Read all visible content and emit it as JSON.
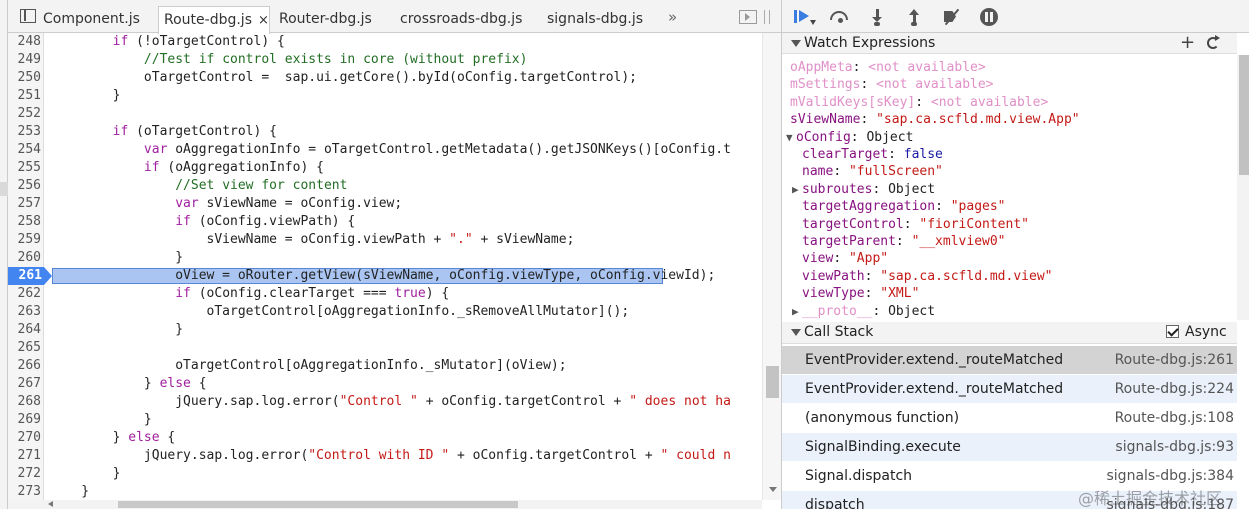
{
  "tabs": [
    {
      "label": "Component.js",
      "active": false
    },
    {
      "label": "Route-dbg.js",
      "active": true,
      "close": "×"
    },
    {
      "label": "Router-dbg.js",
      "active": false
    },
    {
      "label": "crossroads-dbg.js",
      "active": false
    },
    {
      "label": "signals-dbg.js",
      "active": false
    }
  ],
  "more_tabs": "»",
  "editor": {
    "breakpoint_line": "261",
    "lines": [
      {
        "n": "248",
        "parts": [
          {
            "t": "        ",
            "c": ""
          },
          {
            "t": "if",
            "c": "kw"
          },
          {
            "t": " (!oTargetControl) {",
            "c": ""
          }
        ]
      },
      {
        "n": "249",
        "parts": [
          {
            "t": "            ",
            "c": ""
          },
          {
            "t": "//Test if control exists in core (without prefix)",
            "c": "cm"
          }
        ]
      },
      {
        "n": "250",
        "parts": [
          {
            "t": "            oTargetControl =  sap.ui.getCore().byId(oConfig.targetControl);",
            "c": ""
          }
        ]
      },
      {
        "n": "251",
        "parts": [
          {
            "t": "        }",
            "c": ""
          }
        ]
      },
      {
        "n": "252",
        "parts": []
      },
      {
        "n": "253",
        "parts": [
          {
            "t": "        ",
            "c": ""
          },
          {
            "t": "if",
            "c": "kw"
          },
          {
            "t": " (oTargetControl) {",
            "c": ""
          }
        ]
      },
      {
        "n": "254",
        "parts": [
          {
            "t": "            ",
            "c": ""
          },
          {
            "t": "var",
            "c": "kw"
          },
          {
            "t": " oAggregationInfo = oTargetControl.getMetadata().getJSONKeys()[oConfig.t",
            "c": ""
          }
        ]
      },
      {
        "n": "255",
        "parts": [
          {
            "t": "            ",
            "c": ""
          },
          {
            "t": "if",
            "c": "kw"
          },
          {
            "t": " (oAggregationInfo) {",
            "c": ""
          }
        ]
      },
      {
        "n": "256",
        "parts": [
          {
            "t": "                ",
            "c": ""
          },
          {
            "t": "//Set view for content",
            "c": "cm"
          }
        ]
      },
      {
        "n": "257",
        "parts": [
          {
            "t": "                ",
            "c": ""
          },
          {
            "t": "var",
            "c": "kw"
          },
          {
            "t": " sViewName = oConfig.view;",
            "c": ""
          }
        ]
      },
      {
        "n": "258",
        "parts": [
          {
            "t": "                ",
            "c": ""
          },
          {
            "t": "if",
            "c": "kw"
          },
          {
            "t": " (oConfig.viewPath) {",
            "c": ""
          }
        ]
      },
      {
        "n": "259",
        "parts": [
          {
            "t": "                    sViewName = oConfig.viewPath + ",
            "c": ""
          },
          {
            "t": "\".\"",
            "c": "st"
          },
          {
            "t": " + sViewName;",
            "c": ""
          }
        ]
      },
      {
        "n": "260",
        "parts": [
          {
            "t": "                }",
            "c": ""
          }
        ]
      },
      {
        "n": "261",
        "parts": [
          {
            "t": "                oView = oRouter.getView(sViewName, oConfig.viewType, oConfig.viewId);",
            "c": ""
          }
        ]
      },
      {
        "n": "262",
        "parts": [
          {
            "t": "                ",
            "c": ""
          },
          {
            "t": "if",
            "c": "kw"
          },
          {
            "t": " (oConfig.clearTarget === ",
            "c": ""
          },
          {
            "t": "true",
            "c": "kw"
          },
          {
            "t": ") {",
            "c": ""
          }
        ]
      },
      {
        "n": "263",
        "parts": [
          {
            "t": "                    oTargetControl[oAggregationInfo._sRemoveAllMutator]();",
            "c": ""
          }
        ]
      },
      {
        "n": "264",
        "parts": [
          {
            "t": "                }",
            "c": ""
          }
        ]
      },
      {
        "n": "265",
        "parts": []
      },
      {
        "n": "266",
        "parts": [
          {
            "t": "                oTargetControl[oAggregationInfo._sMutator](oView);",
            "c": ""
          }
        ]
      },
      {
        "n": "267",
        "parts": [
          {
            "t": "            } ",
            "c": ""
          },
          {
            "t": "else",
            "c": "kw"
          },
          {
            "t": " {",
            "c": ""
          }
        ]
      },
      {
        "n": "268",
        "parts": [
          {
            "t": "                jQuery.sap.log.error(",
            "c": ""
          },
          {
            "t": "\"Control \"",
            "c": "st"
          },
          {
            "t": " + oConfig.targetControl + ",
            "c": ""
          },
          {
            "t": "\" does not ha",
            "c": "st"
          }
        ]
      },
      {
        "n": "269",
        "parts": [
          {
            "t": "            }",
            "c": ""
          }
        ]
      },
      {
        "n": "270",
        "parts": [
          {
            "t": "        } ",
            "c": ""
          },
          {
            "t": "else",
            "c": "kw"
          },
          {
            "t": " {",
            "c": ""
          }
        ]
      },
      {
        "n": "271",
        "parts": [
          {
            "t": "            jQuery.sap.log.error(",
            "c": ""
          },
          {
            "t": "\"Control with ID \"",
            "c": "st"
          },
          {
            "t": " + oConfig.targetControl + ",
            "c": ""
          },
          {
            "t": "\" could n",
            "c": "st"
          }
        ]
      },
      {
        "n": "272",
        "parts": [
          {
            "t": "        }",
            "c": ""
          }
        ]
      },
      {
        "n": "273",
        "parts": [
          {
            "t": "    }",
            "c": ""
          }
        ]
      },
      {
        "n": "274",
        "parts": []
      }
    ]
  },
  "watch": {
    "title": "Watch Expressions",
    "add": "+",
    "items": [
      {
        "key": "oAppMeta",
        "value": "<not available>",
        "type": "na",
        "indent": 0,
        "dim": true,
        "exp": ""
      },
      {
        "key": "mSettings",
        "value": "<not available>",
        "type": "na",
        "indent": 0,
        "dim": true,
        "exp": ""
      },
      {
        "key": "mValidKeys[sKey]",
        "value": "<not available>",
        "type": "na",
        "indent": 0,
        "dim": true,
        "exp": ""
      },
      {
        "key": "sViewName",
        "value": "\"sap.ca.scfld.md.view.App\"",
        "type": "s",
        "indent": 0,
        "dim": false,
        "exp": ""
      },
      {
        "key": "oConfig",
        "value": "Object",
        "type": "o",
        "indent": 0,
        "dim": false,
        "exp": "▼"
      },
      {
        "key": "clearTarget",
        "value": "false",
        "type": "b",
        "indent": 1,
        "dim": false,
        "exp": ""
      },
      {
        "key": "name",
        "value": "\"fullScreen\"",
        "type": "s",
        "indent": 1,
        "dim": false,
        "exp": ""
      },
      {
        "key": "subroutes",
        "value": "Object",
        "type": "o",
        "indent": 1,
        "dim": false,
        "exp": "▶"
      },
      {
        "key": "targetAggregation",
        "value": "\"pages\"",
        "type": "s",
        "indent": 1,
        "dim": false,
        "exp": ""
      },
      {
        "key": "targetControl",
        "value": "\"fioriContent\"",
        "type": "s",
        "indent": 1,
        "dim": false,
        "exp": ""
      },
      {
        "key": "targetParent",
        "value": "\"__xmlview0\"",
        "type": "s",
        "indent": 1,
        "dim": false,
        "exp": ""
      },
      {
        "key": "view",
        "value": "\"App\"",
        "type": "s",
        "indent": 1,
        "dim": false,
        "exp": ""
      },
      {
        "key": "viewPath",
        "value": "\"sap.ca.scfld.md.view\"",
        "type": "s",
        "indent": 1,
        "dim": false,
        "exp": ""
      },
      {
        "key": "viewType",
        "value": "\"XML\"",
        "type": "s",
        "indent": 1,
        "dim": false,
        "exp": ""
      },
      {
        "key": "__proto__",
        "value": "Object",
        "type": "o",
        "indent": 1,
        "dim": true,
        "exp": "▶"
      }
    ]
  },
  "callstack": {
    "title": "Call Stack",
    "async_label": "Async",
    "async_checked": true,
    "frames": [
      {
        "fn": "EventProvider.extend._routeMatched",
        "loc": "Route-dbg.js:261",
        "state": "sel"
      },
      {
        "fn": "EventProvider.extend._routeMatched",
        "loc": "Route-dbg.js:224",
        "state": "alt"
      },
      {
        "fn": "(anonymous function)",
        "loc": "Route-dbg.js:108",
        "state": ""
      },
      {
        "fn": "SignalBinding.execute",
        "loc": "signals-dbg.js:93",
        "state": "alt"
      },
      {
        "fn": "Signal.dispatch",
        "loc": "signals-dbg.js:384",
        "state": ""
      },
      {
        "fn": "dispatch",
        "loc": "signals-dbg.js:187",
        "state": "alt"
      }
    ]
  },
  "watermark": "@稀土掘金技术社区"
}
